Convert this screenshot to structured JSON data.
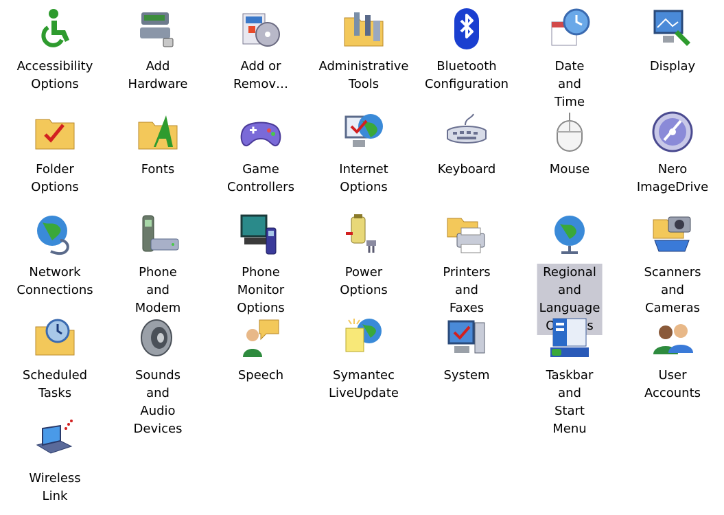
{
  "window": {
    "view": "Control Panel - Icons"
  },
  "items": [
    {
      "label": "Accessibility\nOptions",
      "icon": "accessibility-icon"
    },
    {
      "label": "Add Hardware",
      "icon": "add-hardware-icon"
    },
    {
      "label": "Add or\nRemov…",
      "icon": "add-remove-programs-icon"
    },
    {
      "label": "Administrative\nTools",
      "icon": "administrative-tools-icon"
    },
    {
      "label": "Bluetooth\nConfiguration",
      "icon": "bluetooth-icon"
    },
    {
      "label": "Date and Time",
      "icon": "date-time-icon"
    },
    {
      "label": "Display",
      "icon": "display-icon"
    },
    {
      "label": "Folder Options",
      "icon": "folder-options-icon"
    },
    {
      "label": "Fonts",
      "icon": "fonts-icon"
    },
    {
      "label": "Game\nControllers",
      "icon": "game-controller-icon"
    },
    {
      "label": "Internet\nOptions",
      "icon": "internet-options-icon"
    },
    {
      "label": "Keyboard",
      "icon": "keyboard-icon"
    },
    {
      "label": "Mouse",
      "icon": "mouse-icon"
    },
    {
      "label": "Nero\nImageDrive",
      "icon": "nero-imagedrive-icon"
    },
    {
      "label": "Network\nConnections",
      "icon": "network-connections-icon"
    },
    {
      "label": "Phone and\nModem …",
      "icon": "phone-modem-icon"
    },
    {
      "label": "Phone Monitor\nOptions",
      "icon": "phone-monitor-icon"
    },
    {
      "label": "Power Options",
      "icon": "power-options-icon"
    },
    {
      "label": "Printers and\nFaxes",
      "icon": "printers-faxes-icon"
    },
    {
      "label": "Regional and\nLanguage\nOptions",
      "icon": "regional-language-icon",
      "selected": true
    },
    {
      "label": "Scanners and\nCameras",
      "icon": "scanners-cameras-icon"
    },
    {
      "label": "Scheduled\nTasks",
      "icon": "scheduled-tasks-icon"
    },
    {
      "label": "Sounds and\nAudio Devices",
      "icon": "sounds-audio-icon"
    },
    {
      "label": "Speech",
      "icon": "speech-icon"
    },
    {
      "label": "Symantec\nLiveUpdate",
      "icon": "symantec-liveupdate-icon"
    },
    {
      "label": "System",
      "icon": "system-icon"
    },
    {
      "label": "Taskbar and\nStart Menu",
      "icon": "taskbar-start-menu-icon"
    },
    {
      "label": "User Accounts",
      "icon": "user-accounts-icon"
    },
    {
      "label": "Wireless Link",
      "icon": "wireless-link-icon"
    }
  ],
  "colors": {
    "selection": "#c9c9d3"
  }
}
